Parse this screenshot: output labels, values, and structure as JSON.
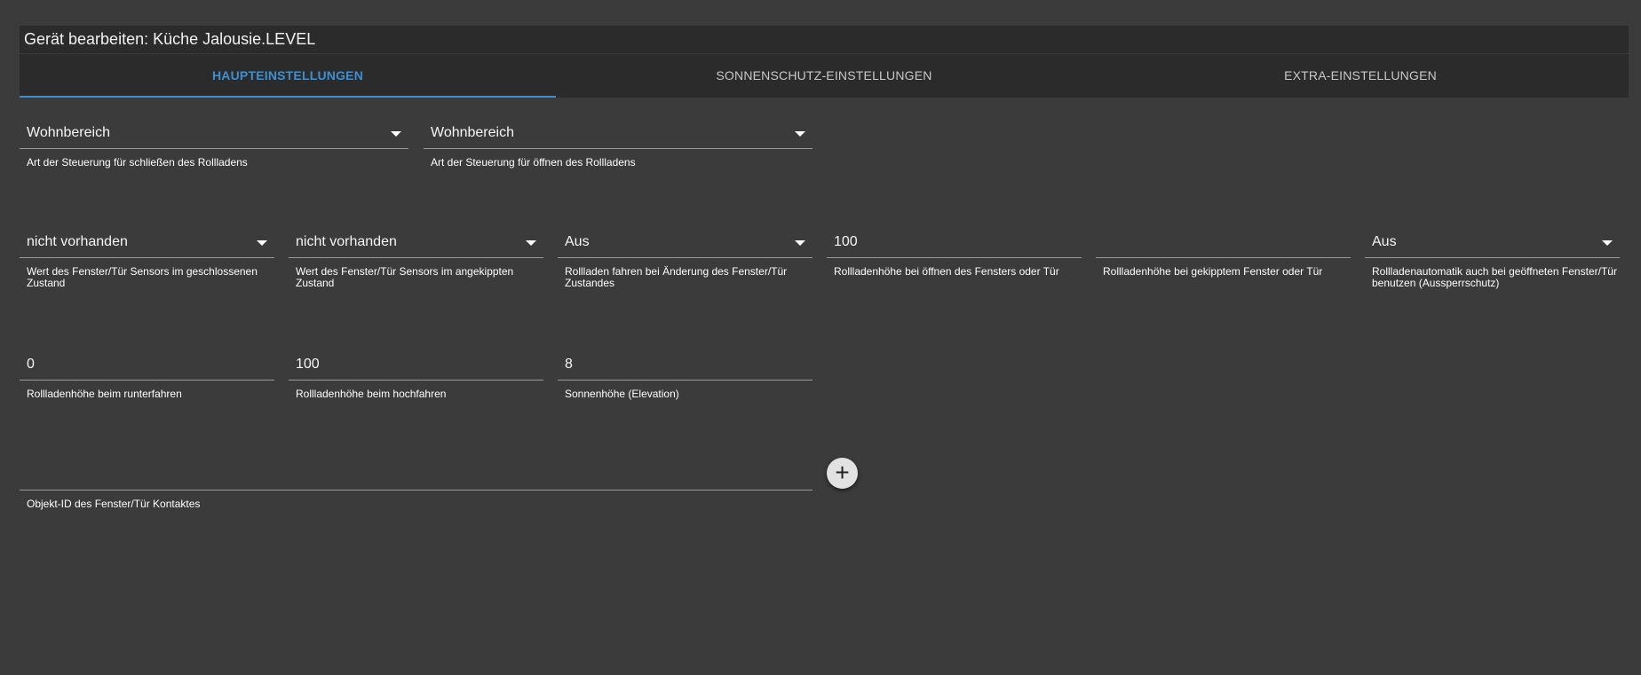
{
  "dialog": {
    "title": "Gerät bearbeiten: Küche Jalousie.LEVEL"
  },
  "tabs": [
    {
      "label": "HAUPTEINSTELLUNGEN",
      "active": true
    },
    {
      "label": "SONNENSCHUTZ-EINSTELLUNGEN",
      "active": false
    },
    {
      "label": "EXTRA-EINSTELLUNGEN",
      "active": false
    }
  ],
  "fields": {
    "close_control": {
      "value": "Wohnbereich",
      "label": "Art der Steuerung für schließen des Rollladens"
    },
    "open_control": {
      "value": "Wohnbereich",
      "label": "Art der Steuerung für öffnen des Rollladens"
    },
    "sensor_closed": {
      "value": "nicht vorhanden",
      "label": "Wert des Fenster/Tür Sensors im geschlossenen Zustand"
    },
    "sensor_tilted": {
      "value": "nicht vorhanden",
      "label": "Wert des Fenster/Tür Sensors im angekippten Zustand"
    },
    "drive_on_change": {
      "value": "Aus",
      "label": "Rollladen fahren bei Änderung des Fenster/Tür Zustandes"
    },
    "height_window_open": {
      "value": "100",
      "label": "Rollladenhöhe bei öffnen des Fensters oder Tür"
    },
    "height_window_tilted": {
      "value": "",
      "label": "Rollladenhöhe bei gekipptem Fenster oder Tür"
    },
    "lockout_protection": {
      "value": "Aus",
      "label": "Rollladenautomatik auch bei geöffneten Fenster/Tür benutzen (Aussperrschutz)"
    },
    "height_down": {
      "value": "0",
      "label": "Rollladenhöhe beim runterfahren"
    },
    "height_up": {
      "value": "100",
      "label": "Rollladenhöhe beim hochfahren"
    },
    "sun_elevation": {
      "value": "8",
      "label": "Sonnenhöhe (Elevation)"
    },
    "contact_object_id": {
      "value": "",
      "label": "Objekt-ID des Fenster/Tür Kontaktes"
    }
  },
  "add_button": {
    "label": "+"
  },
  "icons": {
    "dropdown": "caret-down-icon",
    "add": "plus-icon"
  }
}
